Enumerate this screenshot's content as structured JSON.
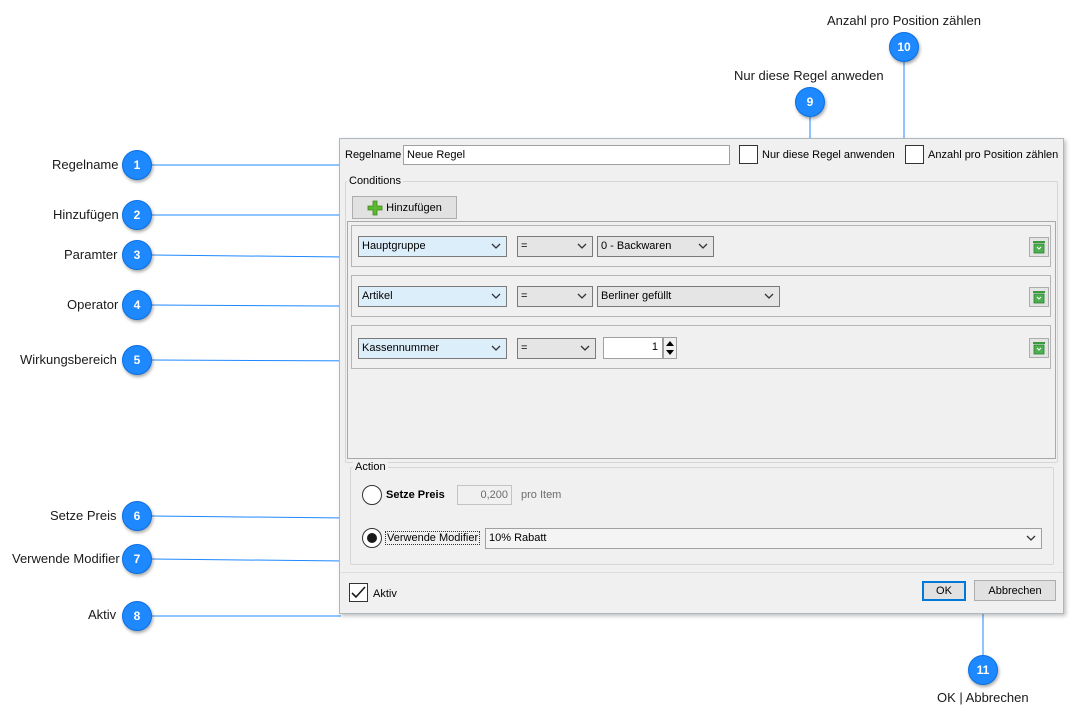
{
  "callouts": [
    {
      "n": "1",
      "label": "Regelname"
    },
    {
      "n": "2",
      "label": "Hinzufügen"
    },
    {
      "n": "3",
      "label": "Paramter"
    },
    {
      "n": "4",
      "label": "Operator"
    },
    {
      "n": "5",
      "label": "Wirkungsbereich"
    },
    {
      "n": "6",
      "label": "Setze Preis"
    },
    {
      "n": "7",
      "label": "Verwende Modifier"
    },
    {
      "n": "8",
      "label": "Aktiv"
    },
    {
      "n": "9",
      "label": "Nur diese Regel anweden"
    },
    {
      "n": "10",
      "label": "Anzahl pro Position zählen"
    },
    {
      "n": "11",
      "label": "OK | Abbrechen"
    }
  ],
  "dialog": {
    "rule_name_label": "Regelname",
    "rule_name_value": "Neue Regel",
    "only_this_rule_label": "Nur diese Regel anwenden",
    "only_this_rule_checked": false,
    "count_per_position_label": "Anzahl pro Position zählen",
    "count_per_position_checked": false,
    "conditions_title": "Conditions",
    "add_button_label": "Hinzufügen",
    "conditions": [
      {
        "parameter": "Hauptgruppe",
        "operator": "=",
        "value": "0 - Backwaren",
        "value_type": "combo"
      },
      {
        "parameter": "Artikel",
        "operator": "=",
        "value": "Berliner gefüllt",
        "value_type": "combo"
      },
      {
        "parameter": "Kassennummer",
        "operator": "=",
        "value": "1",
        "value_type": "spin"
      }
    ],
    "action_title": "Action",
    "set_price_label": "Setze Preis",
    "set_price_value": "0,200",
    "set_price_suffix": "pro Item",
    "set_price_selected": false,
    "use_modifier_label": "Verwende Modifier",
    "use_modifier_selected": true,
    "modifier_value": "10% Rabatt",
    "active_label": "Aktiv",
    "active_checked": true,
    "ok_label": "OK",
    "cancel_label": "Abbrechen"
  },
  "colors": {
    "badge": "#1e88ff",
    "leader_line": "#1e88ff",
    "dialog_bg": "#f0f0f0",
    "combo_selected_bg": "#ddeefb",
    "trash_icon": "#3a9a3a"
  }
}
